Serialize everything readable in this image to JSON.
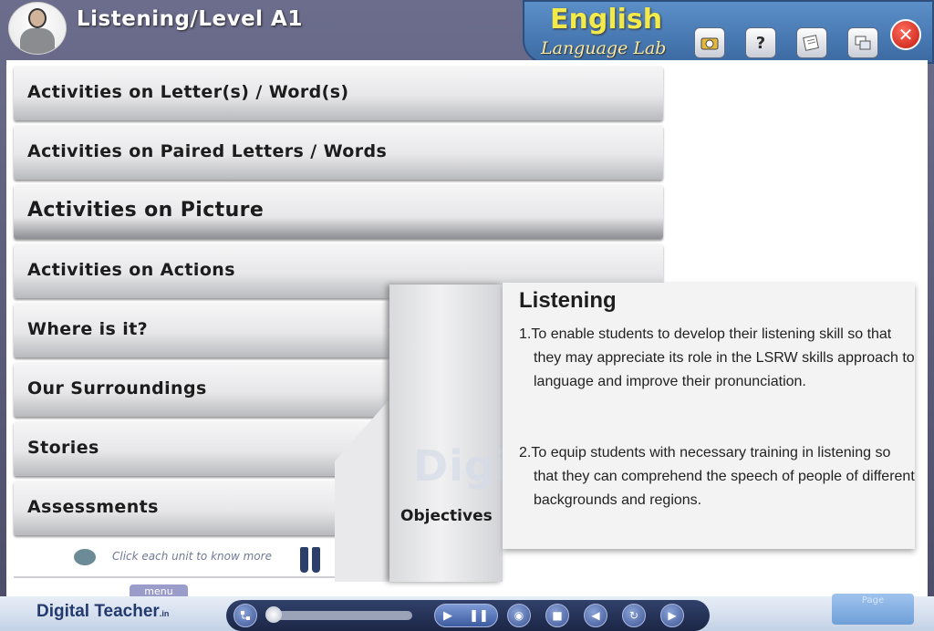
{
  "header": {
    "title": "Listening/Level A1",
    "brand_main": "English",
    "brand_sub": "Language Lab"
  },
  "toolbar": {
    "buttons": [
      "camera-icon",
      "help-icon",
      "notes-icon",
      "window-icon",
      "close-icon"
    ],
    "help_glyph": "?",
    "close_glyph": "✕"
  },
  "menu": {
    "items": [
      {
        "label": "Activities on Letter(s) / Word(s)"
      },
      {
        "label": "Activities on Paired Letters / Words"
      },
      {
        "label": "Activities on Picture"
      },
      {
        "label": "Activities on Actions"
      },
      {
        "label": "Where is it?"
      },
      {
        "label": "Our Surroundings"
      },
      {
        "label": "Stories"
      },
      {
        "label": "Assessments"
      }
    ],
    "hint": "Click each unit to know more"
  },
  "objectives": {
    "tab_label": "Objectives",
    "heading": "Listening",
    "points": [
      "1.To enable students to develop their listening skill so that they may appreciate its role in the LSRW skills approach to language and improve their pronunciation.",
      "2.To equip students with necessary training in listening so that they can comprehend the speech of people of different backgrounds and regions."
    ],
    "watermark": "Digital Teacher"
  },
  "footer": {
    "logo": "Digital Teacher",
    "logo_suffix": ".in",
    "menu_tab": "menu",
    "page_label": "Page",
    "player": {
      "play_glyph": "▶",
      "pause_glyph": "❚❚",
      "volume_glyph": "◉",
      "stop_glyph": "■",
      "prev_glyph": "◀",
      "replay_glyph": "↻",
      "next_glyph": "▶",
      "progress": 0.02
    }
  },
  "colors": {
    "brand_yellow": "#f2e94b",
    "frame": "#5b5d7a",
    "close_red": "#d92616"
  }
}
